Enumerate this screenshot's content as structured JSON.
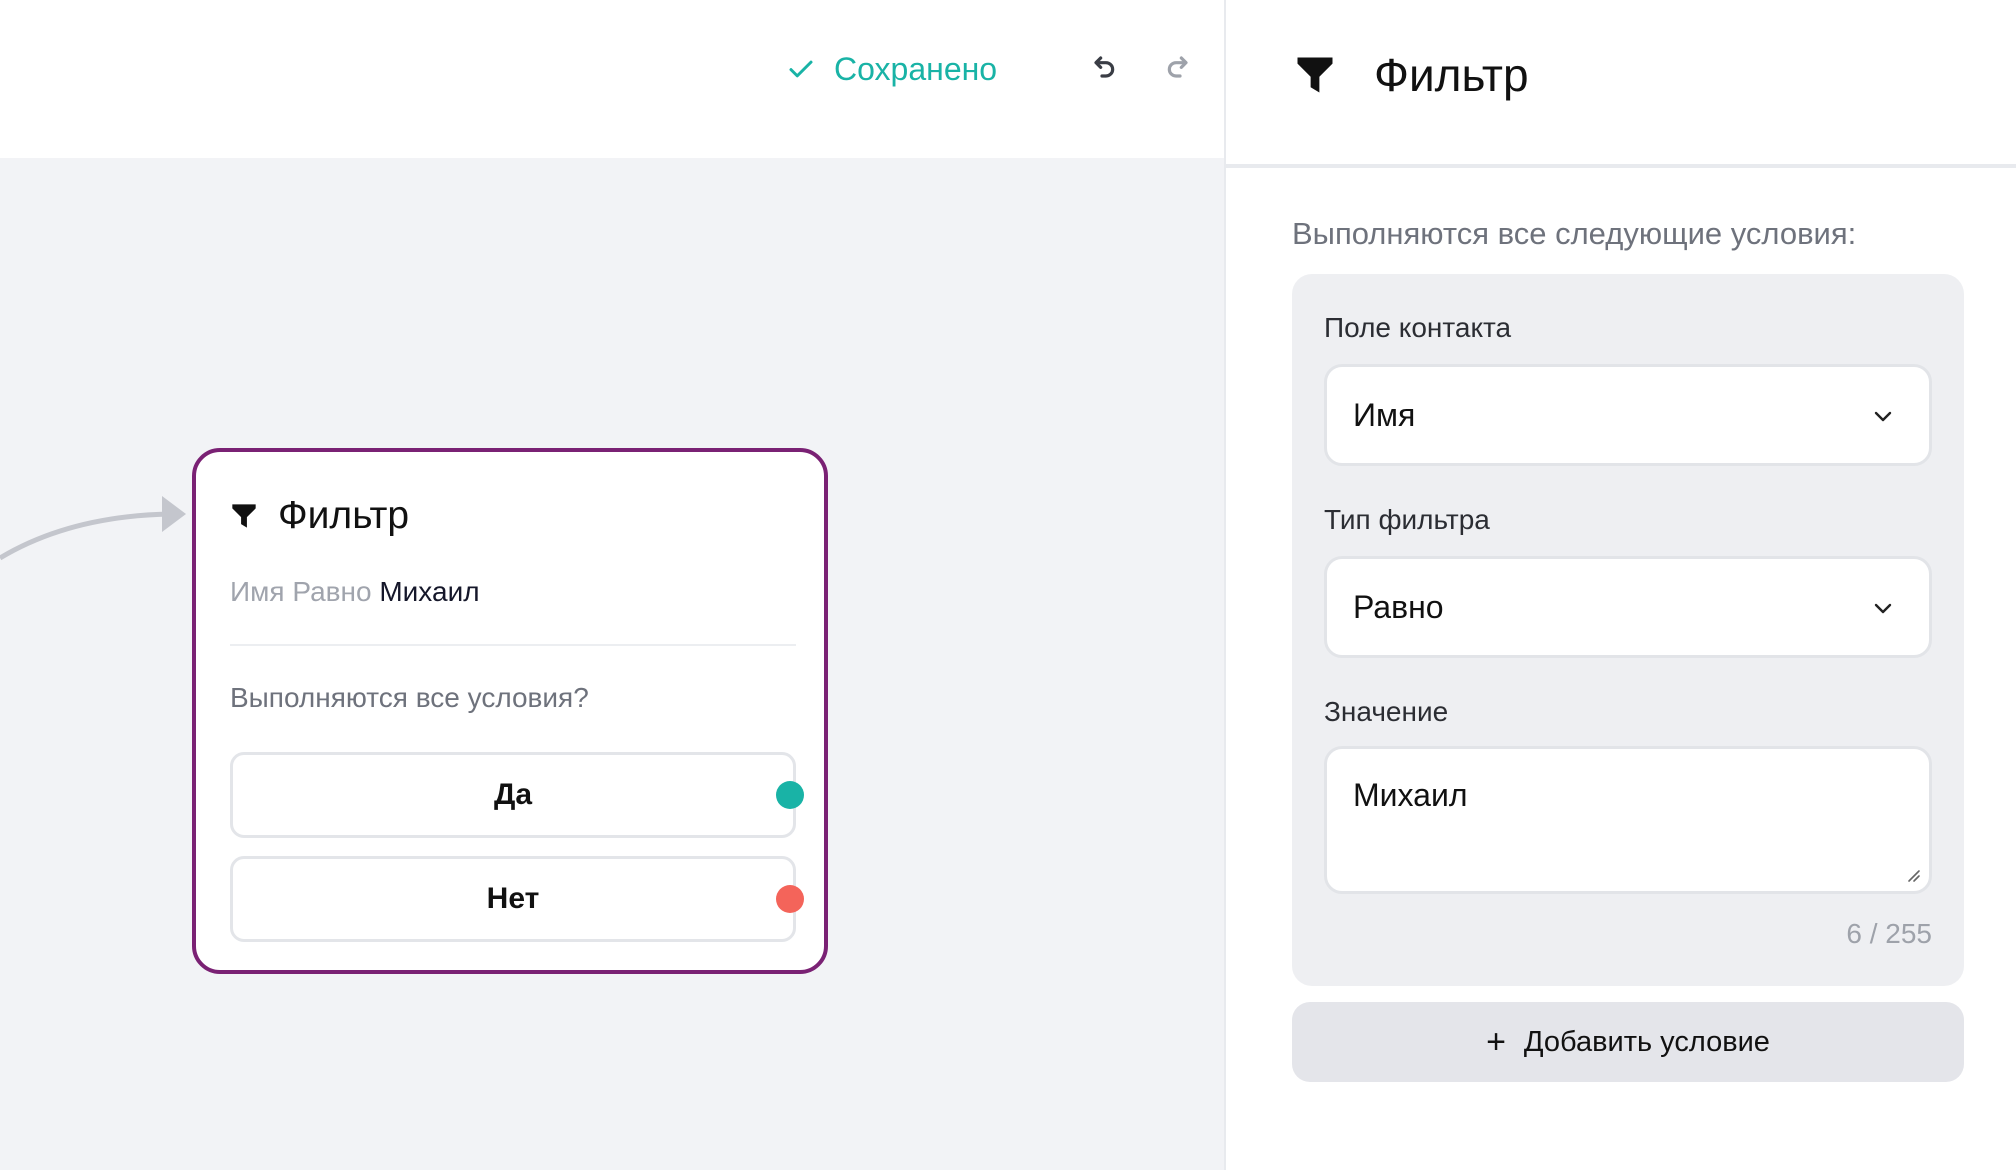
{
  "topbar": {
    "saved_label": "Сохранено",
    "check_icon": "check-icon",
    "undo_icon": "undo-icon",
    "redo_icon": "redo-icon"
  },
  "node": {
    "title": "Фильтр",
    "icon": "filter-icon",
    "condition_field": "Имя",
    "condition_op": "Равно",
    "condition_value": "Михаил",
    "question": "Выполняются все условия?",
    "branches": [
      {
        "label": "Да",
        "color": "#19b3a6"
      },
      {
        "label": "Нет",
        "color": "#f4645a"
      }
    ],
    "border_color": "#7a2174"
  },
  "panel": {
    "title": "Фильтр",
    "icon": "filter-icon",
    "subtitle": "Выполняются все следующие условия:",
    "contact_field_label": "Поле контакта",
    "contact_field_value": "Имя",
    "filter_type_label": "Тип фильтра",
    "filter_type_value": "Равно",
    "value_label": "Значение",
    "value_text": "Михаил",
    "counter": "6 / 255",
    "add_condition_plus": "+",
    "add_condition_label": "Добавить условие"
  },
  "colors": {
    "accent": "#19b3a6",
    "negative": "#f4645a",
    "node_border": "#7a2174"
  }
}
